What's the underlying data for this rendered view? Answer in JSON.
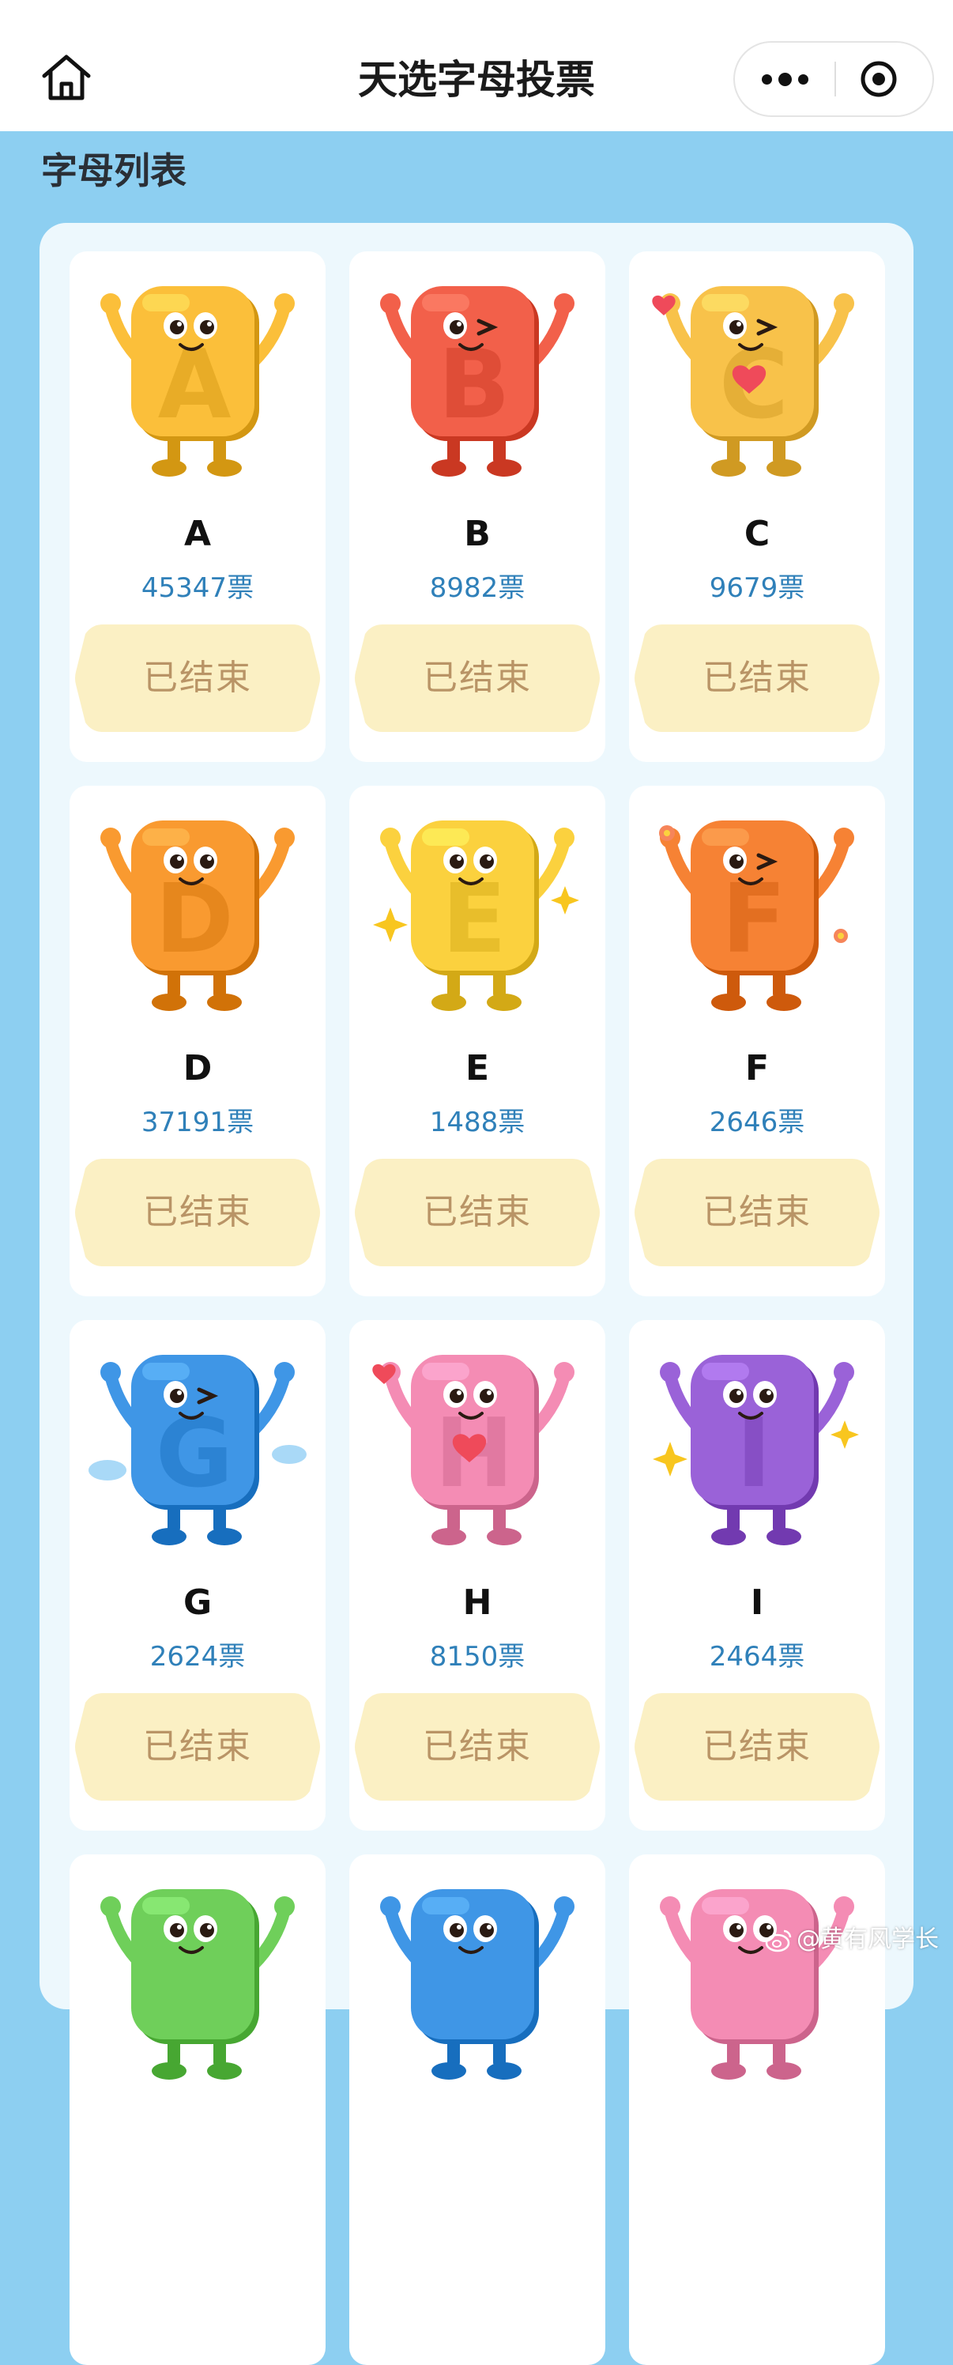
{
  "header": {
    "title": "天选字母投票",
    "home_icon": "home-icon",
    "more_icon": "more-dots-icon",
    "close_icon": "target-close-icon"
  },
  "section": {
    "title": "字母列表"
  },
  "colors": {
    "page_bg": "#8dcff1",
    "panel_bg": "#edf8fd",
    "vote_text": "#2f80b9",
    "button_bg": "#fbf0c4",
    "button_text": "#b99466"
  },
  "letters": [
    {
      "letter": "A",
      "votes": "45347票",
      "button": "已结束",
      "color": "#fbbf3a",
      "eye": "open",
      "extra": "arms-up"
    },
    {
      "letter": "B",
      "votes": "8982票",
      "button": "已结束",
      "color": "#f2604a",
      "eye": "wink",
      "extra": "peace"
    },
    {
      "letter": "C",
      "votes": "9679票",
      "button": "已结束",
      "color": "#f8c24a",
      "eye": "wink",
      "extra": "hearts"
    },
    {
      "letter": "D",
      "votes": "37191票",
      "button": "已结束",
      "color": "#f99a30",
      "eye": "open",
      "extra": "run"
    },
    {
      "letter": "E",
      "votes": "1488票",
      "button": "已结束",
      "color": "#fbd13e",
      "eye": "open",
      "extra": "sparkles"
    },
    {
      "letter": "F",
      "votes": "2646票",
      "button": "已结束",
      "color": "#f68234",
      "eye": "wink",
      "extra": "flowers"
    },
    {
      "letter": "G",
      "votes": "2624票",
      "button": "已结束",
      "color": "#3f96e6",
      "eye": "wink",
      "extra": "clouds"
    },
    {
      "letter": "H",
      "votes": "8150票",
      "button": "已结束",
      "color": "#f48cb4",
      "eye": "open",
      "extra": "hearts"
    },
    {
      "letter": "I",
      "votes": "2464票",
      "button": "已结束",
      "color": "#9a62d8",
      "eye": "open",
      "extra": "sparkles"
    },
    {
      "letter": "",
      "votes": "",
      "button": "",
      "color": "#6fcf5a",
      "eye": "open",
      "extra": "partial"
    },
    {
      "letter": "",
      "votes": "",
      "button": "",
      "color": "#3f96e6",
      "eye": "open",
      "extra": "partial"
    },
    {
      "letter": "",
      "votes": "",
      "button": "",
      "color": "#f48cb4",
      "eye": "open",
      "extra": "partial"
    }
  ],
  "watermark": {
    "text": "@黄有风学长",
    "icon": "weibo-icon"
  }
}
